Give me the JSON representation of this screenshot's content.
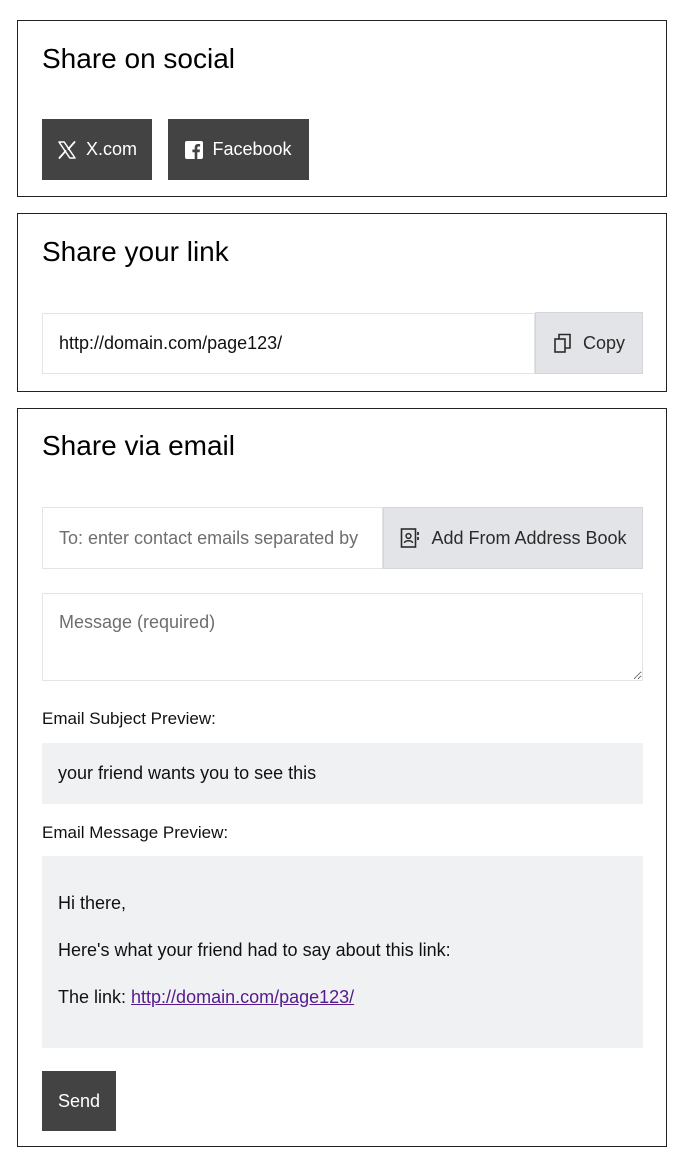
{
  "social": {
    "title": "Share on social",
    "buttons": [
      {
        "label": "X.com",
        "icon": "x-logo-icon"
      },
      {
        "label": "Facebook",
        "icon": "facebook-logo-icon"
      }
    ]
  },
  "link": {
    "title": "Share your link",
    "url": "http://domain.com/page123/",
    "copy_label": "Copy",
    "copy_icon": "copy-icon"
  },
  "email": {
    "title": "Share via email",
    "to_placeholder": "To: enter contact emails separated by",
    "address_book_label": "Add From Address Book",
    "address_book_icon": "address-book-icon",
    "message_placeholder": "Message (required)",
    "subject_label": "Email Subject Preview:",
    "subject_preview": "your friend wants you to see this",
    "message_label": "Email Message Preview:",
    "message_preview": {
      "greeting": "Hi there,",
      "intro": "Here's what your friend had to say about this link:",
      "link_prefix": "The link: ",
      "link_url": "http://domain.com/page123/"
    },
    "send_label": "Send"
  },
  "colors": {
    "dark_button": "#434343",
    "light_button": "#e2e4e8",
    "preview_background": "#f0f1f3",
    "visited_link": "#551a8b"
  }
}
